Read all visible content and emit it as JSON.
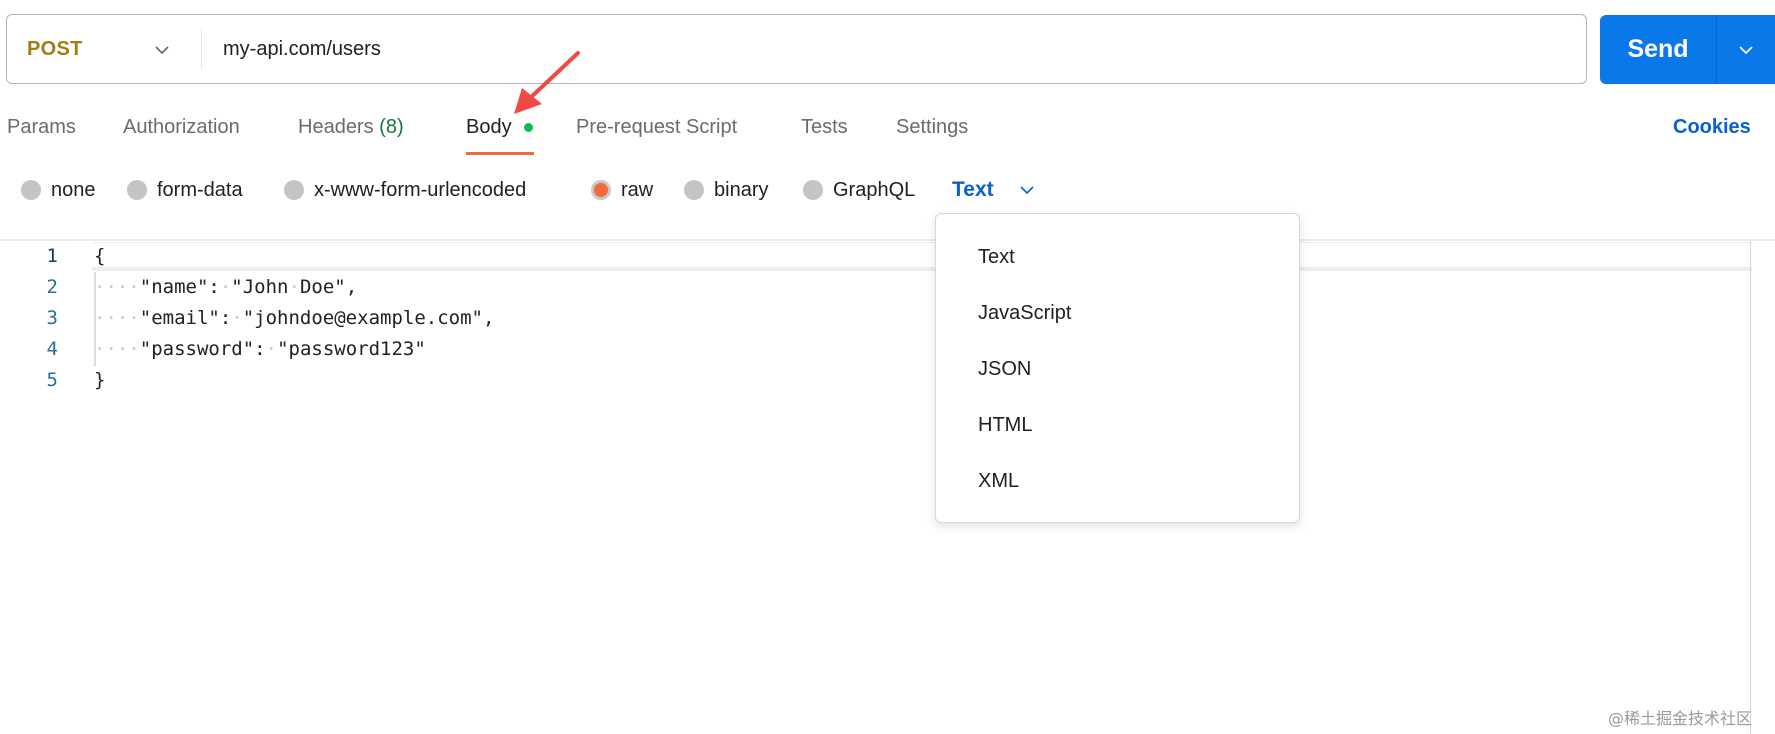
{
  "request": {
    "method": "POST",
    "url": "my-api.com/users",
    "send_label": "Send"
  },
  "tabs": [
    {
      "label": "Params"
    },
    {
      "label": "Authorization"
    },
    {
      "label": "Headers",
      "count": "(8)"
    },
    {
      "label": "Body",
      "active": true
    },
    {
      "label": "Pre-request Script"
    },
    {
      "label": "Tests"
    },
    {
      "label": "Settings"
    }
  ],
  "cookies_label": "Cookies",
  "body_types": [
    {
      "label": "none",
      "checked": false
    },
    {
      "label": "form-data",
      "checked": false
    },
    {
      "label": "x-www-form-urlencoded",
      "checked": false
    },
    {
      "label": "raw",
      "checked": true
    },
    {
      "label": "binary",
      "checked": false
    },
    {
      "label": "GraphQL",
      "checked": false
    }
  ],
  "raw_language": {
    "selected": "Text",
    "options": [
      "Text",
      "JavaScript",
      "JSON",
      "HTML",
      "XML"
    ]
  },
  "editor": {
    "line_numbers": [
      "1",
      "2",
      "3",
      "4",
      "5"
    ],
    "lines": [
      {
        "indent": "",
        "code": "{"
      },
      {
        "indent": "····",
        "code": "\"name\":·\"John·Doe\","
      },
      {
        "indent": "····",
        "code": "\"email\":·\"johndoe@example.com\","
      },
      {
        "indent": "····",
        "code": "\"password\":·\"password123\""
      },
      {
        "indent": "",
        "code": "}"
      }
    ]
  },
  "colors": {
    "method": "#a57c14",
    "send": "#0b78ea",
    "accent_orange": "#f26b3a",
    "link_blue": "#0b5fd1",
    "status_green": "#0cbb52",
    "annotation_red": "#f04a46"
  },
  "watermark": "@稀土掘金技术社区"
}
